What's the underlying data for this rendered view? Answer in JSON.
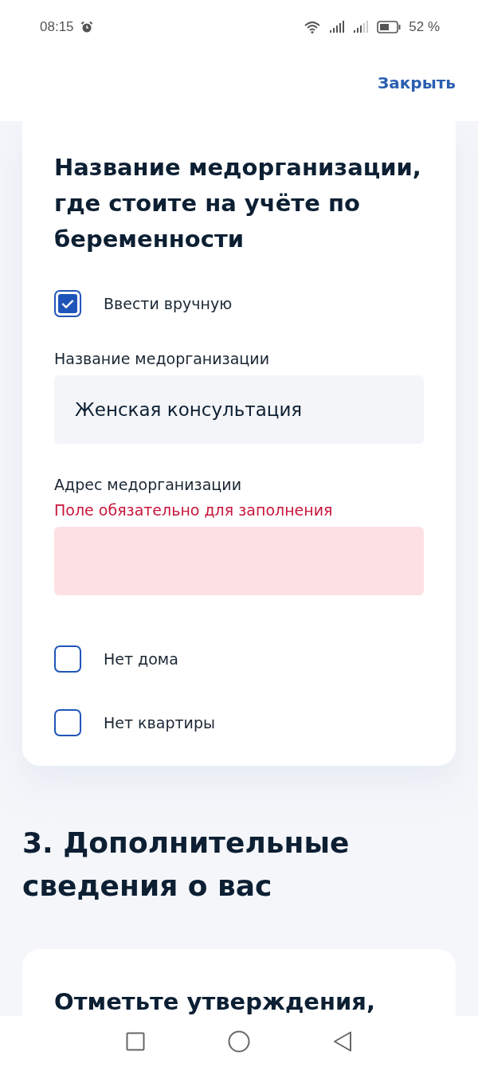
{
  "status_bar": {
    "time": "08:15",
    "battery": "52 %"
  },
  "header": {
    "close": "Закрыть"
  },
  "card": {
    "title": "Название медорганизации, где стоите на учёте по беременности",
    "manual": {
      "label": "Ввести вручную",
      "checked": true
    },
    "fields": [
      {
        "label": "Название медорганизации",
        "value": "Женская консультация",
        "error": false
      },
      {
        "label": "Адрес медорганизации",
        "error_text": "Поле обязательно для заполнения",
        "error": true
      }
    ],
    "options": [
      {
        "label": "Нет дома",
        "checked": false
      },
      {
        "label": "Нет квартиры",
        "checked": false
      }
    ]
  },
  "section": {
    "title": "3. Дополнительные сведения о вас"
  },
  "card2": {
    "title": "Отметьте утверждения,"
  }
}
